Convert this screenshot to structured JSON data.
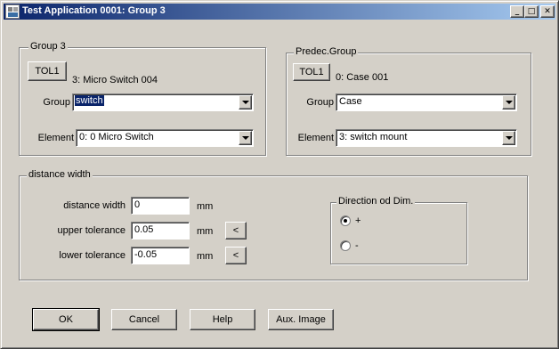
{
  "window": {
    "title": "Test Application 0001: Group 3",
    "minimize": "_",
    "maximize": "□",
    "close": "✕"
  },
  "group": {
    "title": "Group 3",
    "tol_label": "TOL1",
    "info": "3: Micro Switch 004",
    "group_label": "Group",
    "group_value": "switch",
    "element_label": "Element",
    "element_value": "0: 0 Micro Switch"
  },
  "predec": {
    "title": "Predec.Group",
    "tol_label": "TOL1",
    "info": "0: Case 001",
    "group_label": "Group",
    "group_value": "Case",
    "element_label": "Element",
    "element_value": "3: switch mount"
  },
  "distance": {
    "title": "distance width",
    "rows": [
      {
        "label": "distance width",
        "value": "0",
        "unit": "mm",
        "button": ""
      },
      {
        "label": "upper tolerance",
        "value": "0.05",
        "unit": "mm",
        "button": "<"
      },
      {
        "label": "lower tolerance",
        "value": "-0.05",
        "unit": "mm",
        "button": "<"
      }
    ],
    "direction": {
      "title": "Direction od Dim.",
      "options": [
        {
          "label": "+",
          "selected": true
        },
        {
          "label": "-",
          "selected": false
        }
      ]
    }
  },
  "buttons": {
    "ok": "OK",
    "cancel": "Cancel",
    "help": "Help",
    "aux": "Aux. Image"
  }
}
